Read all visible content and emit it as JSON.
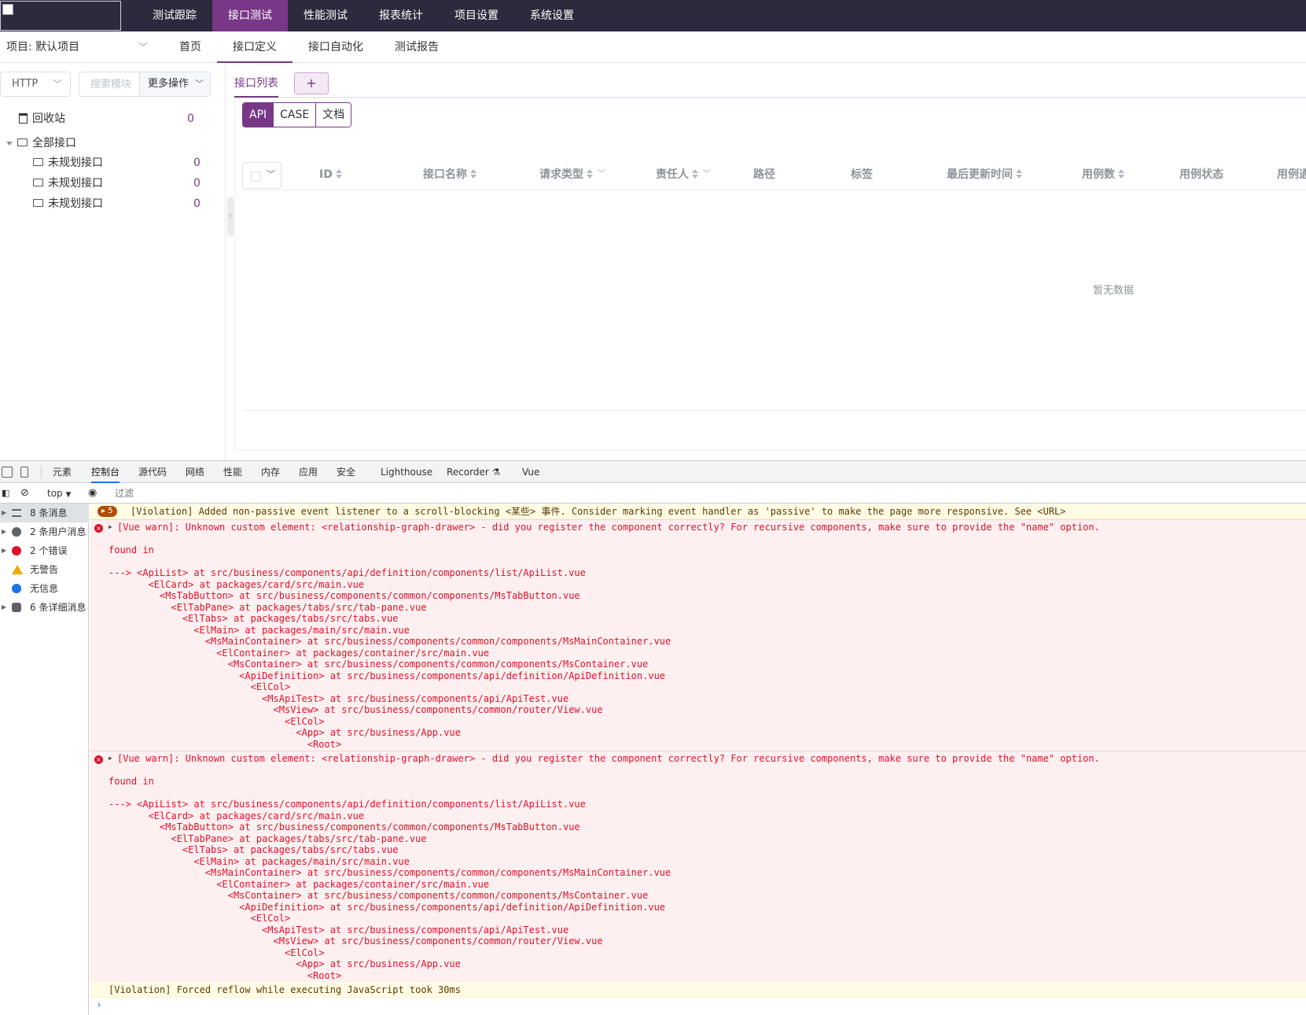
{
  "topnav": {
    "items": [
      "测试跟踪",
      "接口测试",
      "性能测试",
      "报表统计",
      "项目设置",
      "系统设置"
    ],
    "active_index": 1
  },
  "subnav": {
    "project_label": "项目: 默认项目",
    "tabs": [
      "首页",
      "接口定义",
      "接口自动化",
      "测试报告"
    ],
    "active_index": 1
  },
  "sidebar": {
    "protocol": "HTTP",
    "search_placeholder": "搜索模块",
    "more_ops": "更多操作",
    "recycle": {
      "label": "回收站",
      "count": "0"
    },
    "root": {
      "label": "全部接口"
    },
    "children": [
      {
        "label": "未规划接口",
        "count": "0"
      },
      {
        "label": "未规划接口",
        "count": "0"
      },
      {
        "label": "未规划接口",
        "count": "0"
      }
    ]
  },
  "main": {
    "tab_list": "接口列表",
    "tab_add": "+",
    "segments": [
      "API",
      "CASE",
      "文档"
    ],
    "active_segment": 0,
    "columns": [
      "ID",
      "接口名称",
      "请求类型",
      "责任人",
      "路径",
      "标签",
      "最后更新时间",
      "用例数",
      "用例状态",
      "用例通过率"
    ],
    "empty_text": "暂无数据"
  },
  "devtools": {
    "tabs": [
      "元素",
      "控制台",
      "源代码",
      "网络",
      "性能",
      "内存",
      "应用",
      "安全",
      "Lighthouse",
      "Recorder",
      "Vue"
    ],
    "active_tab": 1,
    "context": "top",
    "filter_placeholder": "过滤",
    "sidebar": [
      {
        "label": "8 条消息",
        "icon": "list-icon"
      },
      {
        "label": "2 条用户消息",
        "icon": "user-icon"
      },
      {
        "label": "2 个错误",
        "icon": "error-icon"
      },
      {
        "label": "无警告",
        "icon": "warning-icon"
      },
      {
        "label": "无信息",
        "icon": "info-icon"
      },
      {
        "label": "6 条详细消息",
        "icon": "gear-icon"
      }
    ],
    "violation1": {
      "count": "5",
      "text": "[Violation] Added non-passive event listener to a scroll-blocking <某些> 事件. Consider marking event handler as 'passive' to make the page more responsive. See <URL>"
    },
    "error1": {
      "title": "[Vue warn]: Unknown custom element: <relationship-graph-drawer> - did you register the component correctly? For recursive components, make sure to provide the \"name\" option.",
      "found": "found in",
      "trace": [
        "---> <ApiList> at src/business/components/api/definition/components/list/ApiList.vue",
        "       <ElCard> at packages/card/src/main.vue",
        "         <MsTabButton> at src/business/components/common/components/MsTabButton.vue",
        "           <ElTabPane> at packages/tabs/src/tab-pane.vue",
        "             <ElTabs> at packages/tabs/src/tabs.vue",
        "               <ElMain> at packages/main/src/main.vue",
        "                 <MsMainContainer> at src/business/components/common/components/MsMainContainer.vue",
        "                   <ElContainer> at packages/container/src/main.vue",
        "                     <MsContainer> at src/business/components/common/components/MsContainer.vue",
        "                       <ApiDefinition> at src/business/components/api/definition/ApiDefinition.vue",
        "                         <ElCol>",
        "                           <MsApiTest> at src/business/components/api/ApiTest.vue",
        "                             <MsView> at src/business/components/common/router/View.vue",
        "                               <ElCol>",
        "                                 <App> at src/business/App.vue",
        "                                   <Root>"
      ]
    },
    "error2": {
      "title": "[Vue warn]: Unknown custom element: <relationship-graph-drawer> - did you register the component correctly? For recursive components, make sure to provide the \"name\" option.",
      "found": "found in",
      "trace": [
        "---> <ApiList> at src/business/components/api/definition/components/list/ApiList.vue",
        "       <ElCard> at packages/card/src/main.vue",
        "         <MsTabButton> at src/business/components/common/components/MsTabButton.vue",
        "           <ElTabPane> at packages/tabs/src/tab-pane.vue",
        "             <ElTabs> at packages/tabs/src/tabs.vue",
        "               <ElMain> at packages/main/src/main.vue",
        "                 <MsMainContainer> at src/business/components/common/components/MsMainContainer.vue",
        "                   <ElContainer> at packages/container/src/main.vue",
        "                     <MsContainer> at src/business/components/common/components/MsContainer.vue",
        "                       <ApiDefinition> at src/business/components/api/definition/ApiDefinition.vue",
        "                         <ElCol>",
        "                           <MsApiTest> at src/business/components/api/ApiTest.vue",
        "                             <MsView> at src/business/components/common/router/View.vue",
        "                               <ElCol>",
        "                                 <App> at src/business/App.vue",
        "                                   <Root>"
      ]
    },
    "violation2": {
      "text": "[Violation] Forced reflow while executing JavaScript took 30ms"
    },
    "prompt": "›"
  },
  "colors": {
    "topbar_bg": "#2d2a3e",
    "accent": "#783887",
    "error_text": "#e0112b",
    "error_bg": "#fef0f0",
    "warn_bg": "#fffbe5"
  }
}
